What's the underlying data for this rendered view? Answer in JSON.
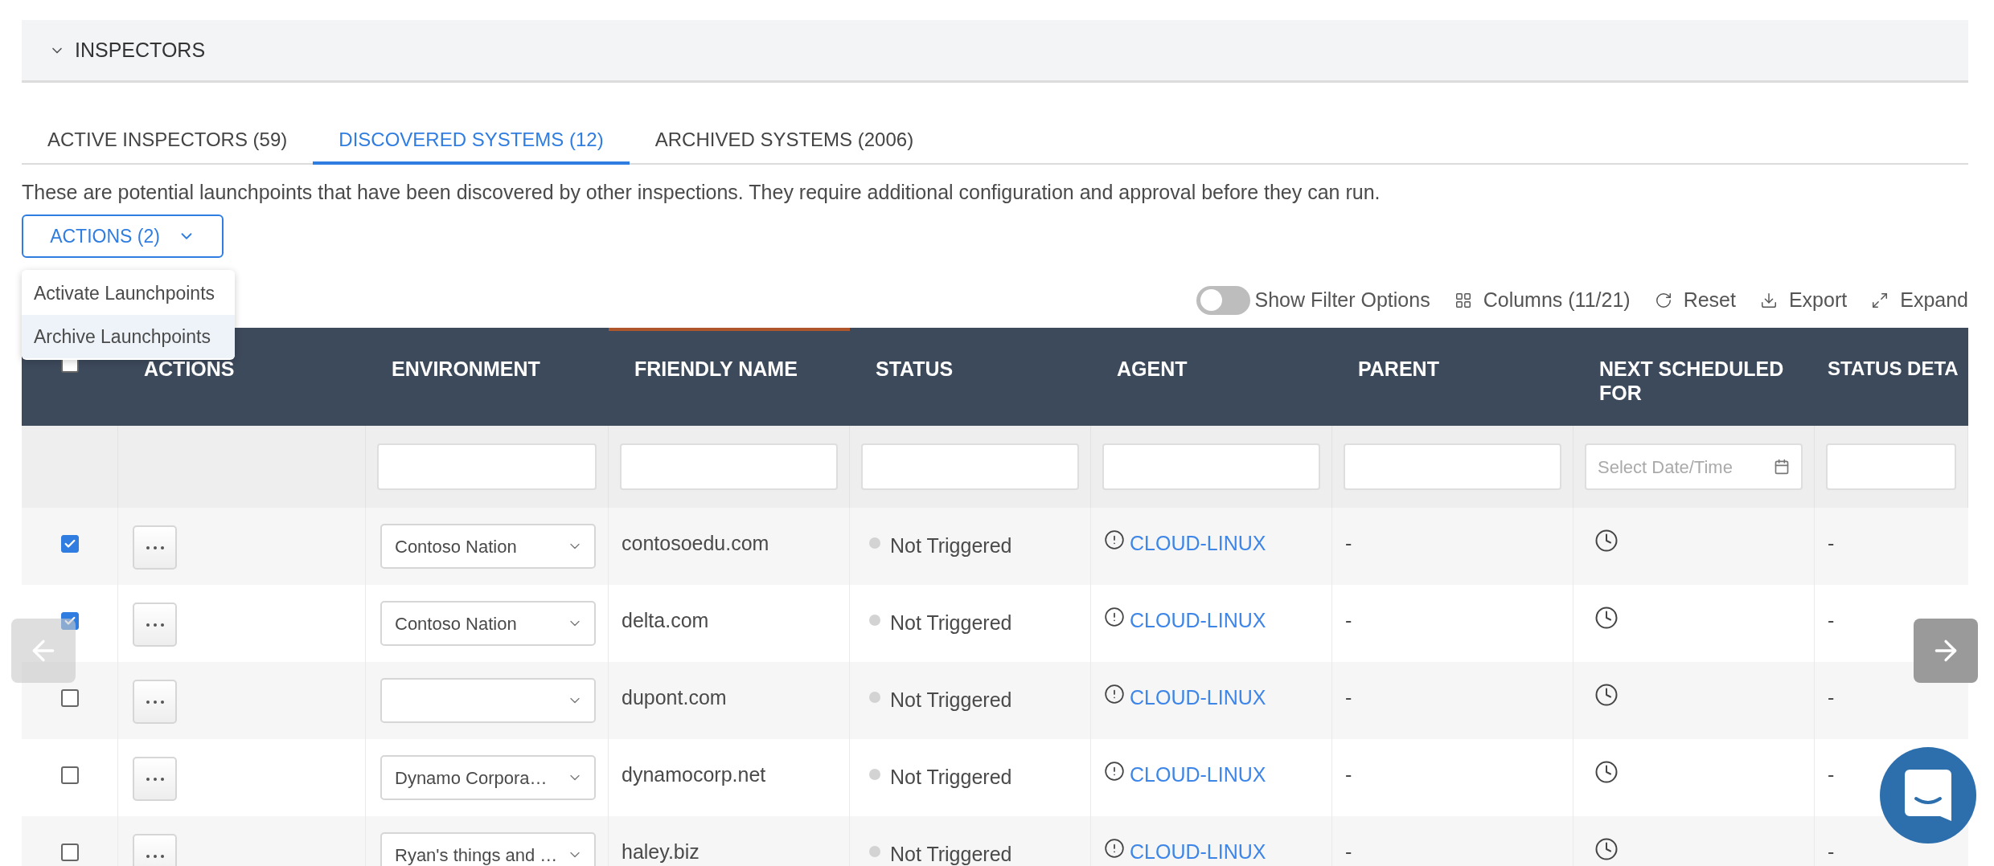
{
  "section": {
    "title": "INSPECTORS",
    "expanded": true
  },
  "tabs": [
    {
      "label": "ACTIVE INSPECTORS (59)",
      "selected": false
    },
    {
      "label": "DISCOVERED SYSTEMS (12)",
      "selected": true
    },
    {
      "label": "ARCHIVED SYSTEMS (2006)",
      "selected": false
    }
  ],
  "description": "These are potential launchpoints that have been discovered by other inspections. They require additional configuration and approval before they can run.",
  "actions_button": {
    "label": "ACTIONS (2)",
    "expanded": true
  },
  "actions_menu": [
    {
      "label": "Activate Launchpoints",
      "highlighted": false
    },
    {
      "label": "Archive Launchpoints",
      "highlighted": true
    }
  ],
  "toolbar": {
    "filter_toggle": {
      "label": "Show Filter Options",
      "on": false
    },
    "buttons": [
      {
        "kind": "columns",
        "label": "Columns (11/21)"
      },
      {
        "kind": "reset",
        "label": "Reset"
      },
      {
        "kind": "export",
        "label": "Export"
      },
      {
        "kind": "expand",
        "label": "Expand"
      }
    ]
  },
  "table": {
    "select_all": {
      "checked": false
    },
    "columns": [
      {
        "label": "ACTIONS",
        "sorted": false
      },
      {
        "label": "ENVIRONMENT",
        "sorted": false
      },
      {
        "label": "FRIENDLY NAME",
        "sorted": true
      },
      {
        "label": "STATUS",
        "sorted": false
      },
      {
        "label": "AGENT",
        "sorted": false
      },
      {
        "label": "PARENT",
        "sorted": false
      },
      {
        "label": "NEXT SCHEDULED FOR",
        "sorted": false
      },
      {
        "label": "STATUS DETA",
        "sorted": false
      }
    ],
    "filters": [
      {
        "kind": "none"
      },
      {
        "kind": "text"
      },
      {
        "kind": "text"
      },
      {
        "kind": "text"
      },
      {
        "kind": "text"
      },
      {
        "kind": "text"
      },
      {
        "kind": "date",
        "placeholder": "Select Date/Time"
      },
      {
        "kind": "text"
      }
    ],
    "rows": [
      {
        "checked": true,
        "environment": "Contoso Nation",
        "friendly_name": "contosoedu.com",
        "status": "Not Triggered",
        "agent": "CLOUD-LINUX",
        "parent": "-",
        "status_details": "-"
      },
      {
        "checked": true,
        "environment": "Contoso Nation",
        "friendly_name": "delta.com",
        "status": "Not Triggered",
        "agent": "CLOUD-LINUX",
        "parent": "-",
        "status_details": "-"
      },
      {
        "checked": false,
        "friendly_name": "dupont.com",
        "status": "Not Triggered",
        "agent": "CLOUD-LINUX",
        "parent": "-",
        "status_details": "-"
      },
      {
        "checked": false,
        "environment": "Dynamo Corpora…",
        "friendly_name": "dynamocorp.net",
        "status": "Not Triggered",
        "agent": "CLOUD-LINUX",
        "parent": "-",
        "status_details": "-"
      },
      {
        "checked": false,
        "environment": "Ryan's things and …",
        "friendly_name": "haley.biz",
        "status": "Not Triggered",
        "agent": "CLOUD-LINUX",
        "parent": "-",
        "status_details": "-"
      }
    ]
  }
}
